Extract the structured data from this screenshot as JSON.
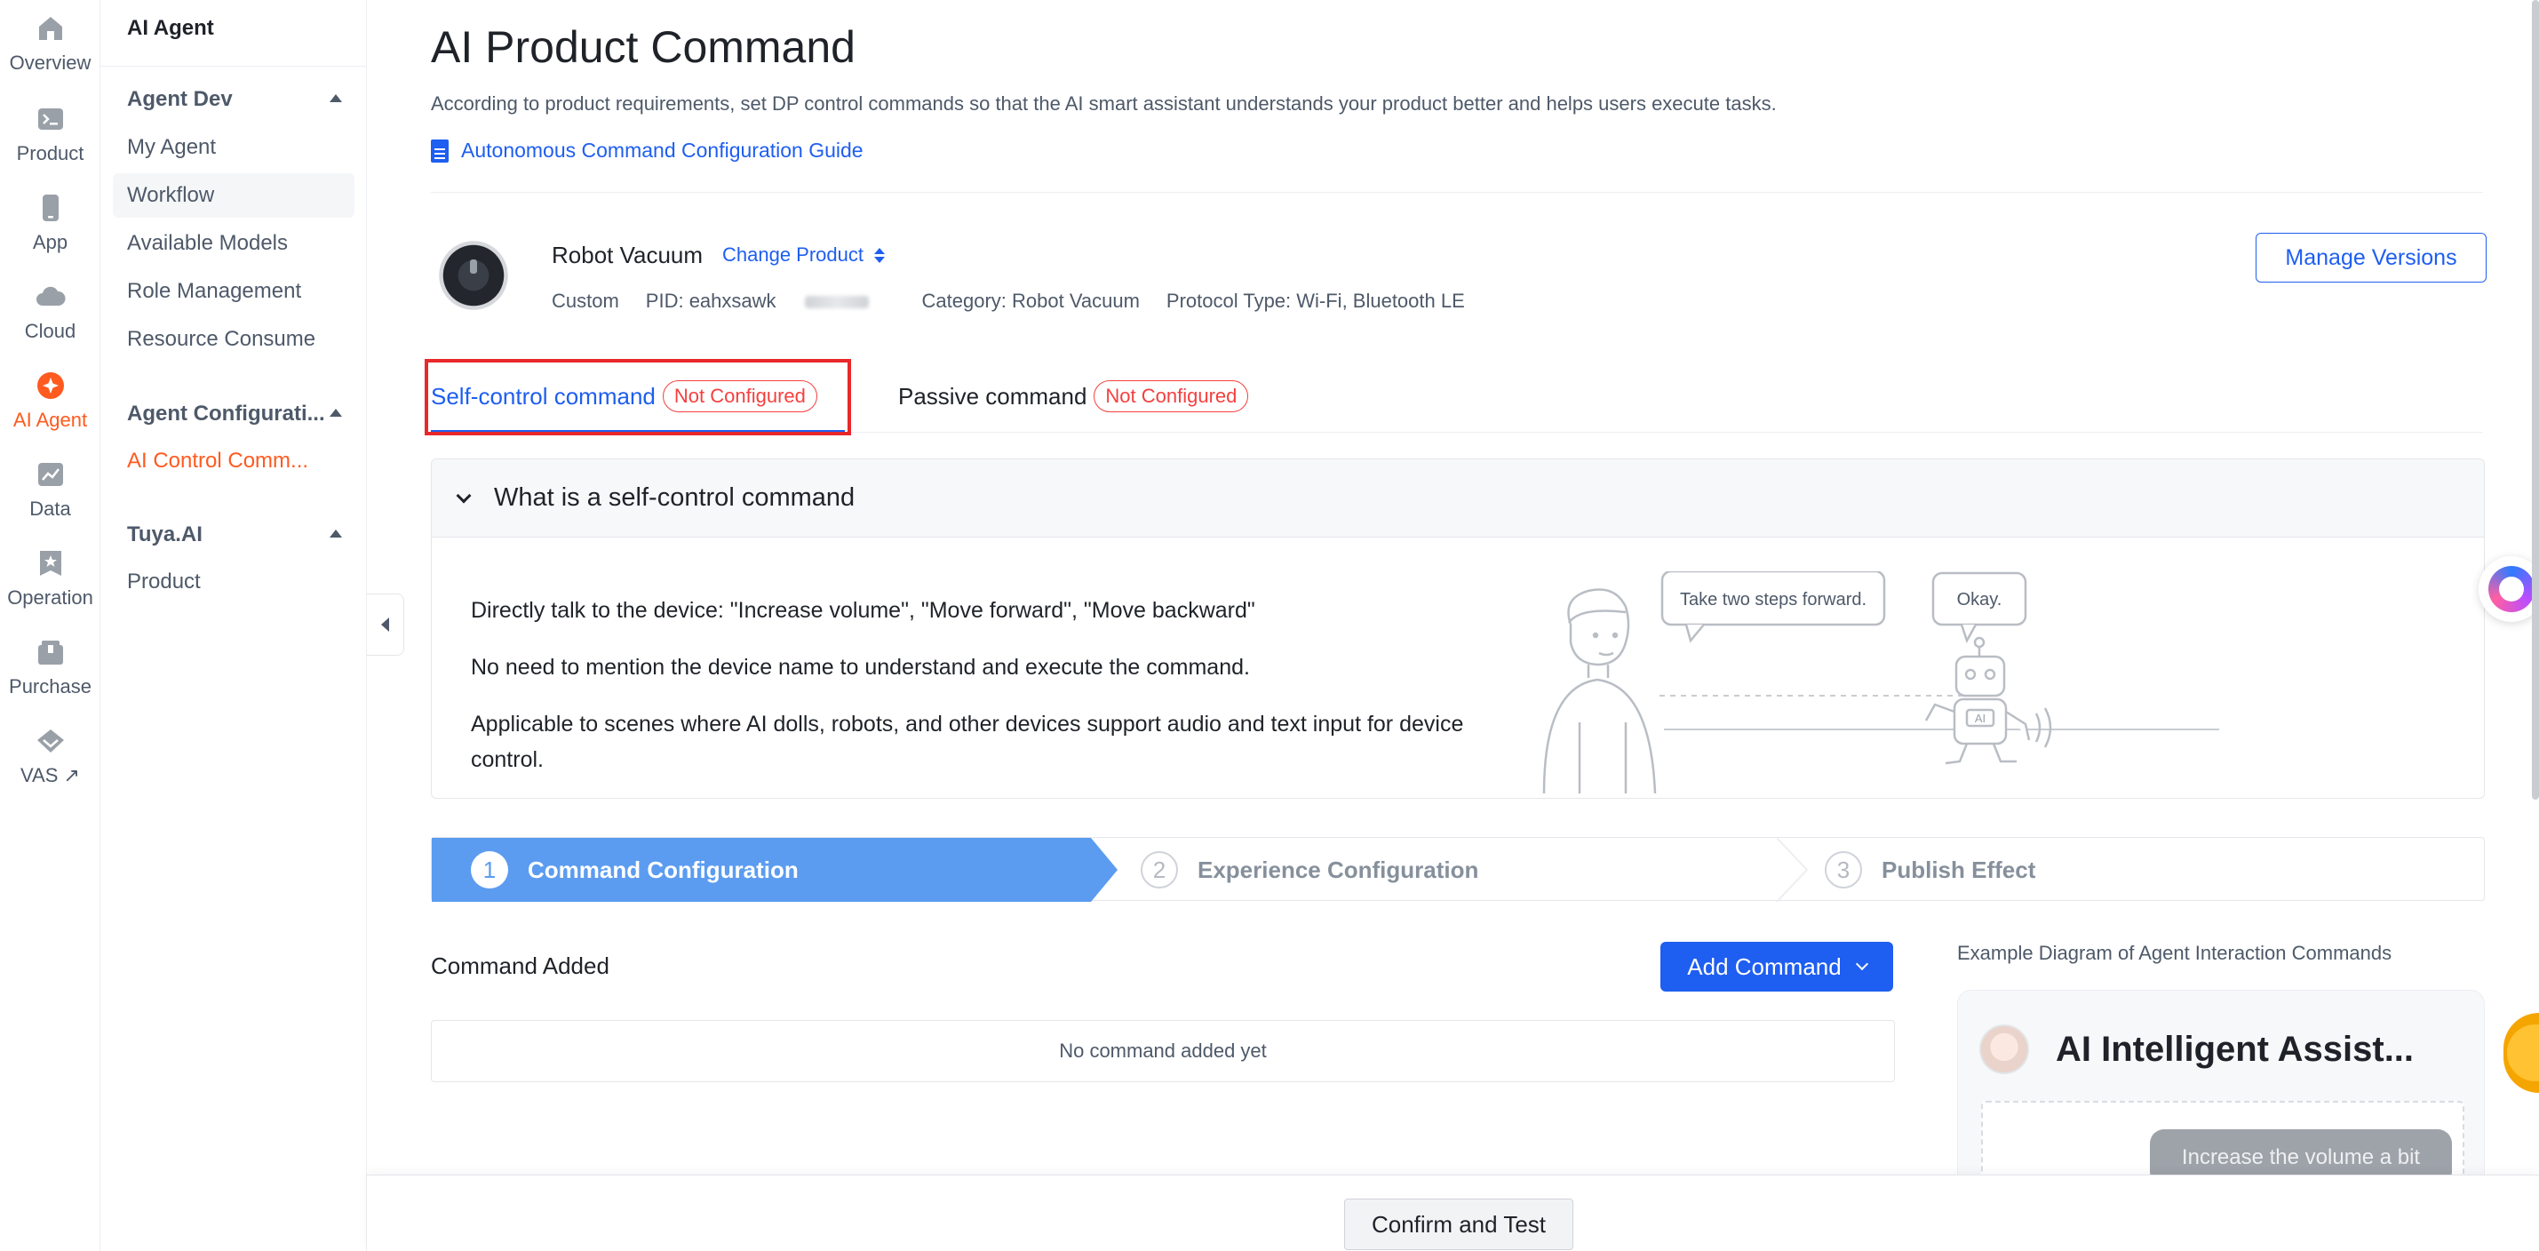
{
  "rail": {
    "items": [
      {
        "label": "Overview",
        "icon": "home-icon"
      },
      {
        "label": "Product",
        "icon": "terminal-icon"
      },
      {
        "label": "App",
        "icon": "phone-icon"
      },
      {
        "label": "Cloud",
        "icon": "cloud-icon"
      },
      {
        "label": "AI Agent",
        "icon": "sparkle-icon"
      },
      {
        "label": "Data",
        "icon": "chart-icon"
      },
      {
        "label": "Operation",
        "icon": "star-badge-icon"
      },
      {
        "label": "Purchase",
        "icon": "box-icon"
      },
      {
        "label": "VAS",
        "icon": "diamond-icon"
      }
    ],
    "vas_external": "↗"
  },
  "sidebar": {
    "app_name": "AI Agent",
    "groups": [
      {
        "label": "Agent Dev",
        "items": [
          "My Agent",
          "Workflow",
          "Available Models",
          "Role Management",
          "Resource Consume"
        ]
      },
      {
        "label": "Agent Configurati...",
        "items": [
          "AI Control Comm..."
        ]
      },
      {
        "label": "Tuya.AI",
        "items": [
          "Product"
        ]
      }
    ]
  },
  "page": {
    "title": "AI Product Command",
    "description": "According to product requirements, set DP control commands so that the AI smart assistant understands your product better and helps users execute tasks.",
    "guide_link": "Autonomous Command Configuration Guide"
  },
  "product": {
    "name": "Robot Vacuum",
    "change_label": "Change Product",
    "type": "Custom",
    "pid": "PID: eahxsawk",
    "category": "Category: Robot Vacuum",
    "protocol": "Protocol Type: Wi-Fi, Bluetooth LE",
    "manage_versions": "Manage Versions"
  },
  "tabs": [
    {
      "label": "Self-control command",
      "badge": "Not Configured"
    },
    {
      "label": "Passive command",
      "badge": "Not Configured"
    }
  ],
  "panel": {
    "title": "What is a self-control command",
    "lines": [
      "Directly talk to the device: \"Increase volume\", \"Move forward\", \"Move backward\"",
      "No need to mention the device name to understand and execute the command.",
      "Applicable to scenes where AI dolls, robots, and other devices support audio and text input for device control."
    ],
    "bubble_person": "Take two steps forward.",
    "bubble_robot": "Okay.",
    "robot_badge": "AI"
  },
  "steps": [
    {
      "num": "1",
      "label": "Command Configuration"
    },
    {
      "num": "2",
      "label": "Experience Configuration"
    },
    {
      "num": "3",
      "label": "Publish Effect"
    }
  ],
  "commands": {
    "title": "Command Added",
    "add_button": "Add Command",
    "empty_text": "No command added yet"
  },
  "example": {
    "title": "Example Diagram of Agent Interaction Commands",
    "assistant_name": "AI Intelligent Assist...",
    "user_message": "Increase the volume a bit"
  },
  "footer": {
    "confirm_button": "Confirm and Test"
  },
  "colors": {
    "primary": "#1e5ef0",
    "accent_orange": "#ff5a1f",
    "danger": "#f53f3f",
    "step_active": "#5b9cf0"
  }
}
